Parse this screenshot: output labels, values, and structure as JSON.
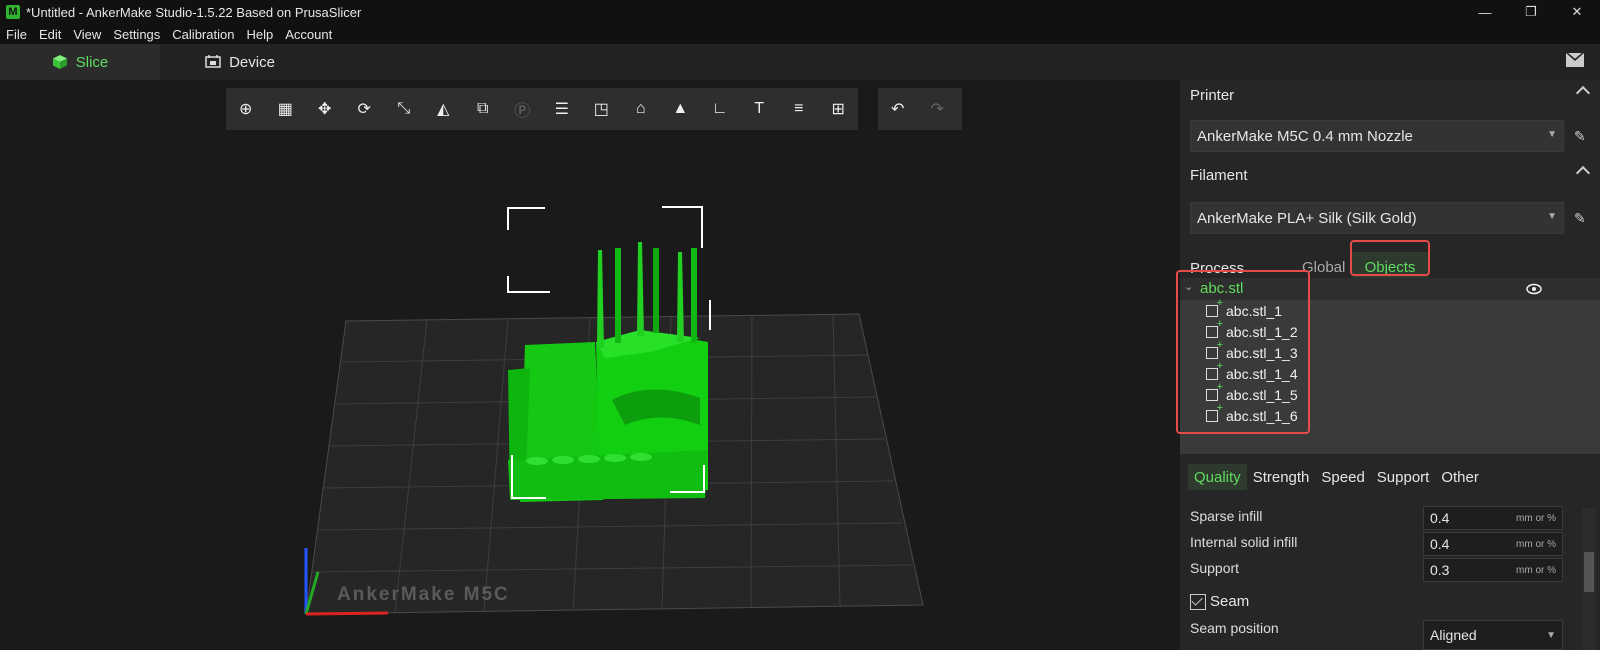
{
  "window": {
    "title": "*Untitled - AnkerMake Studio-1.5.22 Based on PrusaSlicer",
    "logo": "M",
    "controls": [
      "—",
      "❐",
      "✕"
    ]
  },
  "menu": [
    "File",
    "Edit",
    "View",
    "Settings",
    "Calibration",
    "Help",
    "Account"
  ],
  "modes": {
    "slice": "Slice",
    "device": "Device"
  },
  "toolbar": {
    "tools": [
      "add-object",
      "arrange",
      "move",
      "rotate",
      "scale",
      "cut",
      "support-paint",
      "paint-p",
      "split",
      "layer",
      "seam",
      "auto-orient",
      "measure",
      "text",
      "layers",
      "shape"
    ],
    "undo": "undo",
    "redo": "redo"
  },
  "plate": {
    "label": "AnkerMake M5C"
  },
  "printer": {
    "section": "Printer",
    "value": "AnkerMake M5C 0.4 mm Nozzle"
  },
  "filament": {
    "section": "Filament",
    "value": "AnkerMake PLA+ Silk (Silk Gold)"
  },
  "process": {
    "section": "Process",
    "tab_global": "Global",
    "tab_objects": "Objects"
  },
  "tree": {
    "root": "abc.stl",
    "items": [
      "abc.stl_1",
      "abc.stl_1_2",
      "abc.stl_1_3",
      "abc.stl_1_4",
      "abc.stl_1_5",
      "abc.stl_1_6"
    ]
  },
  "subtabs": [
    "Quality",
    "Strength",
    "Speed",
    "Support",
    "Other"
  ],
  "settings": [
    {
      "label": "Sparse infill",
      "value": "0.4",
      "unit": "mm or %"
    },
    {
      "label": "Internal solid infill",
      "value": "0.4",
      "unit": "mm or %"
    },
    {
      "label": "Support",
      "value": "0.3",
      "unit": "mm or %"
    }
  ],
  "seam": {
    "label": "Seam",
    "position_label": "Seam position",
    "position_value": "Aligned"
  },
  "colors": {
    "accent": "#5fdc5f",
    "model": "#0fd20f",
    "highlight": "#e84a4a"
  }
}
